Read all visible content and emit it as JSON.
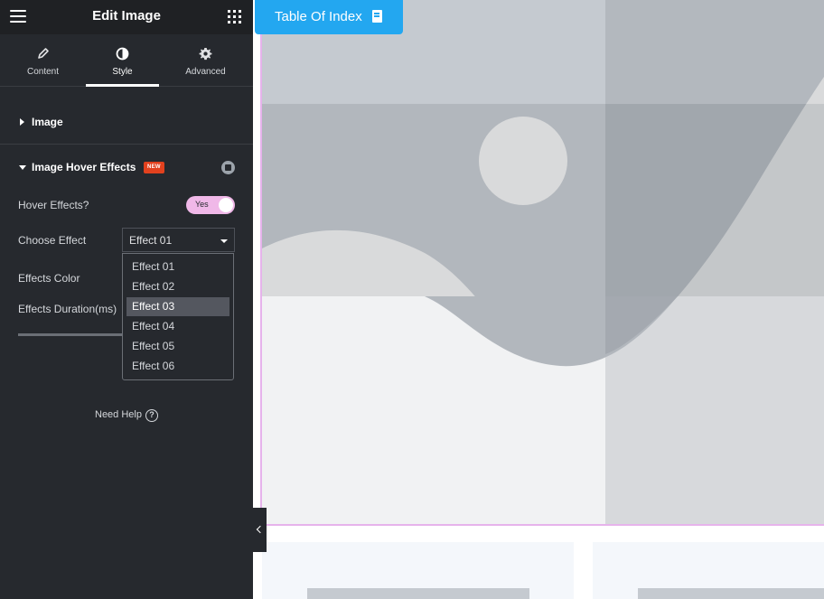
{
  "header": {
    "title": "Edit Image"
  },
  "tabs": [
    {
      "label": "Content",
      "icon": "pencil-icon"
    },
    {
      "label": "Style",
      "icon": "contrast-icon"
    },
    {
      "label": "Advanced",
      "icon": "gear-icon"
    }
  ],
  "sections": {
    "image": {
      "label": "Image"
    },
    "hover": {
      "label": "Image Hover Effects",
      "badge": "NEW"
    }
  },
  "controls": {
    "hover_effects": {
      "label": "Hover Effects?",
      "toggle_text": "Yes"
    },
    "choose_effect": {
      "label": "Choose Effect",
      "value": "Effect 01"
    },
    "effects_color": {
      "label": "Effects Color"
    },
    "effects_duration": {
      "label": "Effects Duration(ms)"
    }
  },
  "dropdown": {
    "options": [
      "Effect 01",
      "Effect 02",
      "Effect 03",
      "Effect 04",
      "Effect 05",
      "Effect 06"
    ],
    "highlighted": "Effect 03"
  },
  "help": {
    "label": "Need Help",
    "icon_glyph": "?"
  },
  "preview": {
    "toc_label": "Table Of Index"
  },
  "colors": {
    "sidebar_bg": "#26292e",
    "toggle_on": "#f0b8e8",
    "accent_blue": "#23a7f0",
    "badge_new": "#e2411e"
  }
}
